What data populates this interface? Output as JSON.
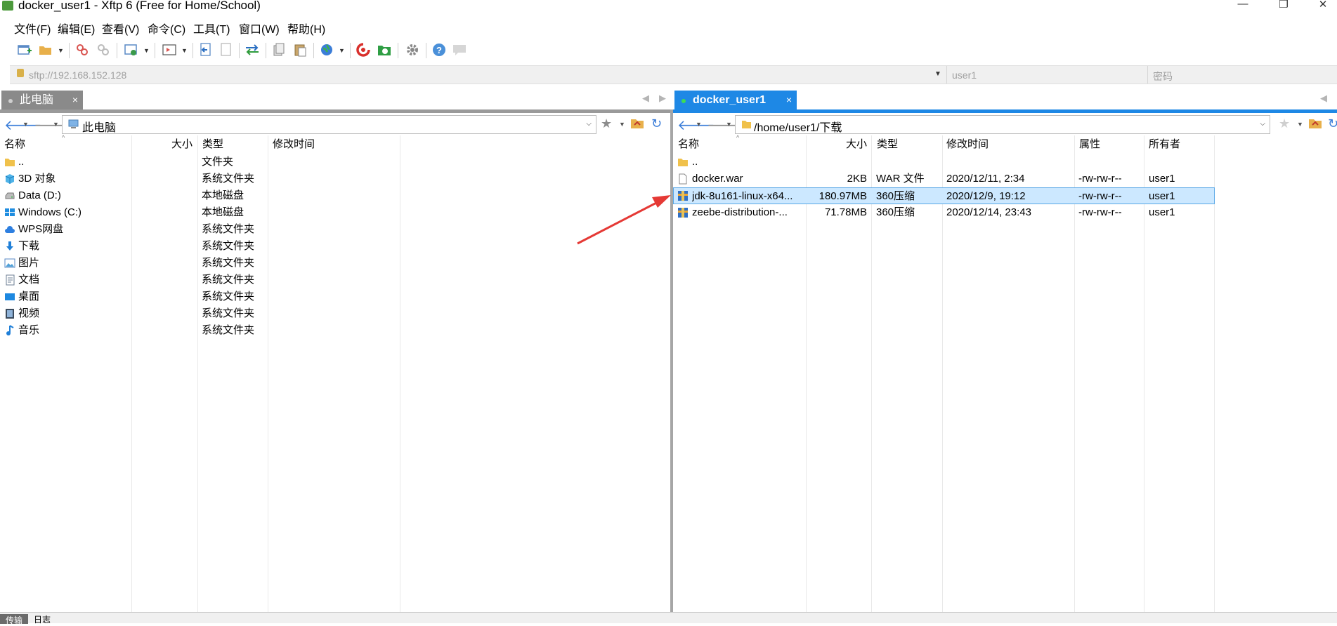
{
  "window": {
    "title": "docker_user1 - Xftp 6 (Free for Home/School)",
    "minimize": "—",
    "restore": "❐",
    "close": "✕"
  },
  "menu": [
    "文件(F)",
    "编辑(E)",
    "查看(V)",
    "命令(C)",
    "工具(T)",
    "窗口(W)",
    "帮助(H)"
  ],
  "address": {
    "host_placeholder": "sftp://192.168.152.128",
    "user_placeholder": "user1",
    "password_placeholder": "密码"
  },
  "left": {
    "tab_label": "此电脑",
    "tab_close": "×",
    "path": "此电脑",
    "columns": [
      "名称",
      "大小",
      "类型",
      "修改时间"
    ],
    "rows": [
      {
        "name": "..",
        "size": "",
        "type": "文件夹",
        "icon": "folder-up-icon"
      },
      {
        "name": "3D 对象",
        "size": "",
        "type": "系统文件夹",
        "icon": "3d-objects-icon"
      },
      {
        "name": "Data (D:)",
        "size": "",
        "type": "本地磁盘",
        "icon": "drive-icon"
      },
      {
        "name": "Windows (C:)",
        "size": "",
        "type": "本地磁盘",
        "icon": "windows-drive-icon"
      },
      {
        "name": "WPS网盘",
        "size": "",
        "type": "系统文件夹",
        "icon": "cloud-icon"
      },
      {
        "name": "下载",
        "size": "",
        "type": "系统文件夹",
        "icon": "download-icon"
      },
      {
        "name": "图片",
        "size": "",
        "type": "系统文件夹",
        "icon": "pictures-icon"
      },
      {
        "name": "文档",
        "size": "",
        "type": "系统文件夹",
        "icon": "documents-icon"
      },
      {
        "name": "桌面",
        "size": "",
        "type": "系统文件夹",
        "icon": "desktop-icon"
      },
      {
        "name": "视频",
        "size": "",
        "type": "系统文件夹",
        "icon": "videos-icon"
      },
      {
        "name": "音乐",
        "size": "",
        "type": "系统文件夹",
        "icon": "music-icon"
      }
    ]
  },
  "right": {
    "tab_label": "docker_user1",
    "tab_close": "×",
    "path": "/home/user1/下载",
    "columns": [
      "名称",
      "大小",
      "类型",
      "修改时间",
      "属性",
      "所有者"
    ],
    "rows": [
      {
        "name": "..",
        "size": "",
        "type": "",
        "modified": "",
        "attr": "",
        "owner": "",
        "icon": "folder-up-icon"
      },
      {
        "name": "docker.war",
        "size": "2KB",
        "type": "WAR 文件",
        "modified": "2020/12/11, 2:34",
        "attr": "-rw-rw-r--",
        "owner": "user1",
        "icon": "file-icon"
      },
      {
        "name": "jdk-8u161-linux-x64...",
        "size": "180.97MB",
        "type": "360压缩",
        "modified": "2020/12/9, 19:12",
        "attr": "-rw-rw-r--",
        "owner": "user1",
        "icon": "archive-icon"
      },
      {
        "name": "zeebe-distribution-...",
        "size": "71.78MB",
        "type": "360压缩",
        "modified": "2020/12/14, 23:43",
        "attr": "-rw-rw-r--",
        "owner": "user1",
        "icon": "archive-icon"
      }
    ]
  },
  "bottom": {
    "tab1": "传输",
    "tab2": "日志"
  },
  "colors": {
    "active_tab": "#1e88e5",
    "selection": "#cce8ff",
    "annotation_arrow": "#e53935"
  }
}
